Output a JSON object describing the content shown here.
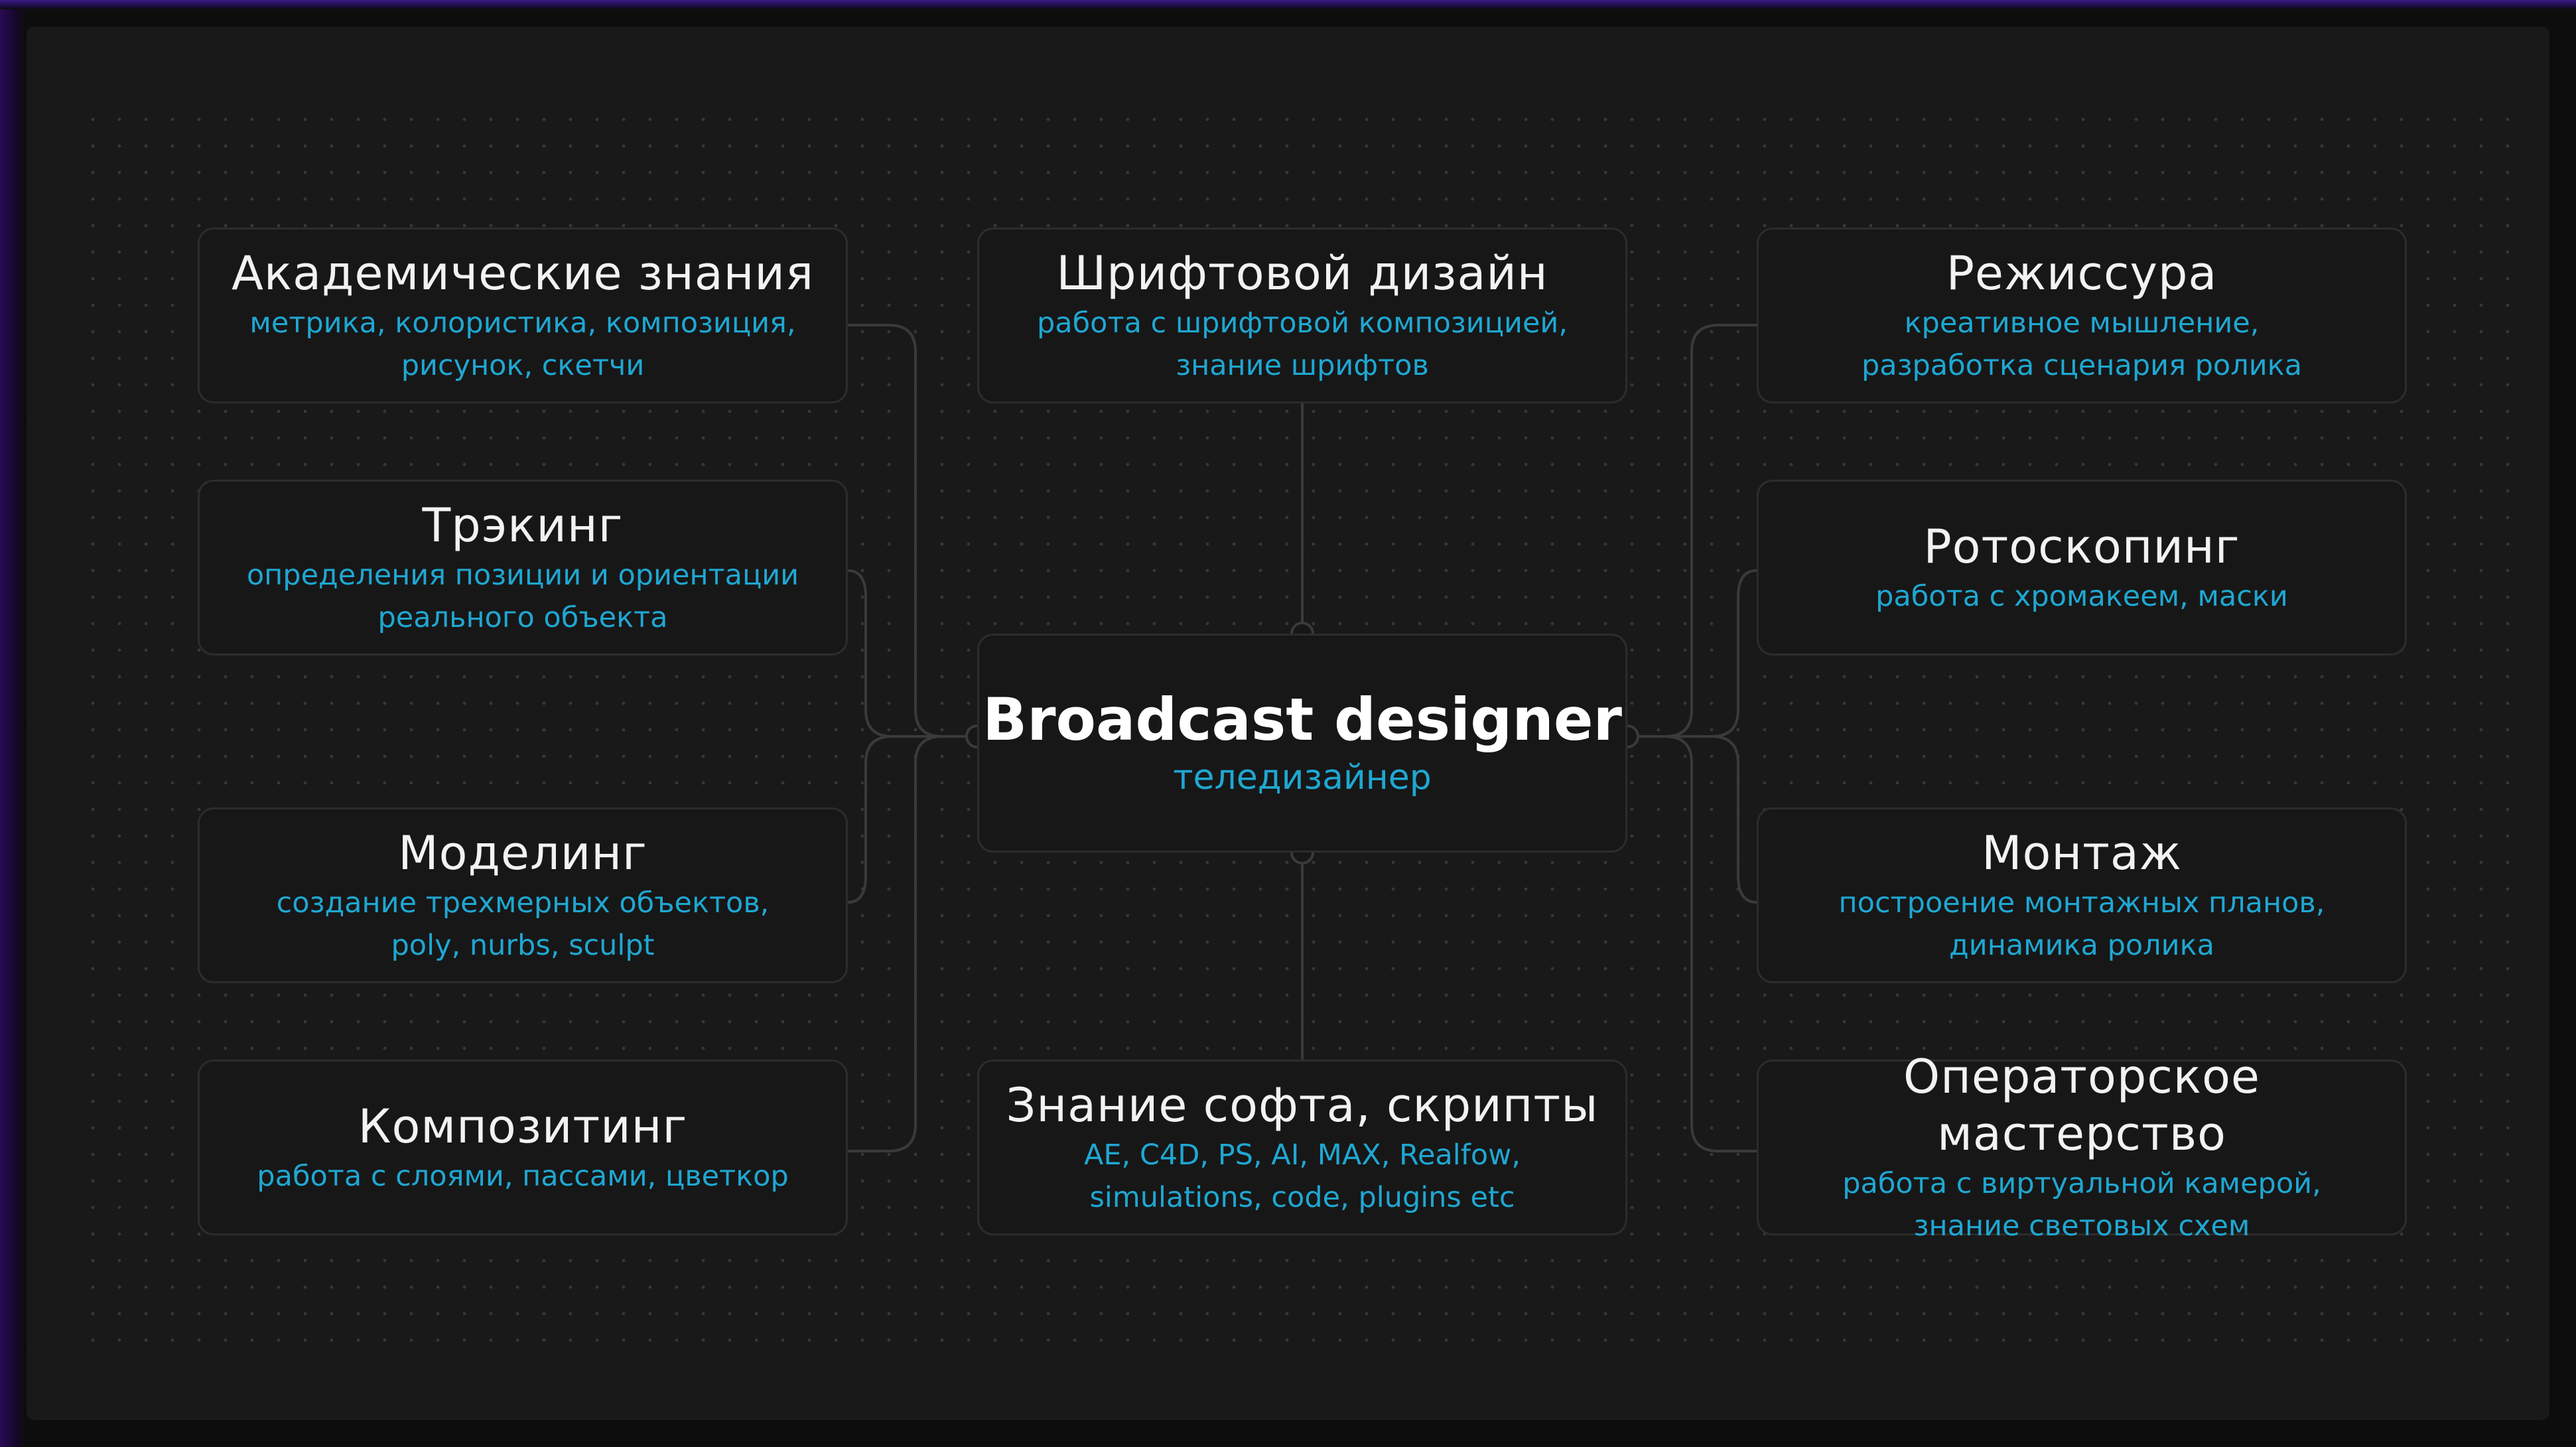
{
  "center": {
    "title": "Broadcast designer",
    "subtitle": "теледизайнер"
  },
  "cards": {
    "academic": {
      "title": "Академические знания",
      "desc": "метрика, колористика, композиция,\nрисунок, скетчи"
    },
    "tracking": {
      "title": "Трэкинг",
      "desc": "определения позиции и ориентации\nреального объекта"
    },
    "modeling": {
      "title": "Моделинг",
      "desc": "создание трехмерных объектов,\npoly, nurbs, sculpt"
    },
    "compositing": {
      "title": "Композитинг",
      "desc": "работа с слоями, пассами, цветкор"
    },
    "typography": {
      "title": "Шрифтовой дизайн",
      "desc": "работа с шрифтовой композицией,\nзнание шрифтов"
    },
    "software": {
      "title": "Знание софта, скрипты",
      "desc": "AE, C4D, PS, AI, MAX,  Realfow,\nsimulations, code, plugins etc"
    },
    "directing": {
      "title": "Режиссура",
      "desc": "креативное мышление,\nразработка сценария ролика"
    },
    "rotoscoping": {
      "title": "Ротоскопинг",
      "desc": "работа с хромакеем, маски"
    },
    "editing": {
      "title": "Монтаж",
      "desc": "построение монтажных планов,\nдинамика ролика"
    },
    "camerawork": {
      "title": "Операторское мастерство",
      "desc": "работа с виртуальной камерой,\nзнание световых схем"
    }
  },
  "colors": {
    "background": "#191919",
    "card_border": "#2c2c2c",
    "title_text": "#f2f2f2",
    "accent": "#1fa7d2",
    "connector": "#3a3a3a"
  }
}
